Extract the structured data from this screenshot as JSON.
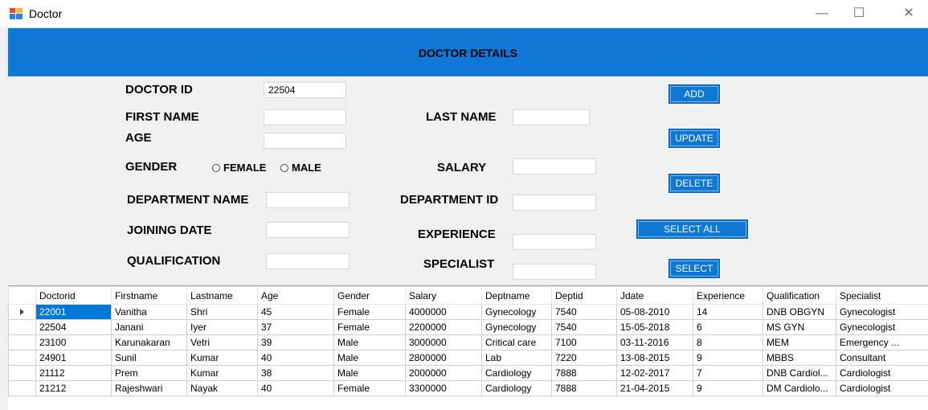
{
  "window": {
    "title": "Doctor",
    "minimize": "—",
    "maximize": "☐",
    "close": "✕"
  },
  "header": {
    "title": "DOCTOR DETAILS"
  },
  "form": {
    "doctor_id_label": "DOCTOR ID",
    "doctor_id_value": "22504",
    "first_name_label": "FIRST NAME",
    "last_name_label": "LAST NAME",
    "age_label": "AGE",
    "gender_label": "GENDER",
    "female_label": "FEMALE",
    "male_label": "MALE",
    "salary_label": "SALARY",
    "department_name_label": "DEPARTMENT NAME",
    "department_id_label": "DEPARTMENT ID",
    "joining_date_label": "JOINING DATE",
    "experience_label": "EXPERIENCE",
    "qualification_label": "QUALIFICATION",
    "specialist_label": "SPECIALIST"
  },
  "buttons": {
    "add": "ADD",
    "update": "UPDATE",
    "delete": "DELETE",
    "select_all": "SELECT ALL",
    "select": "SELECT"
  },
  "table": {
    "columns": [
      "Doctorid",
      "Firstname",
      "Lastname",
      "Age",
      "Gender",
      "Salary",
      "Deptname",
      "Deptid",
      "Jdate",
      "Experience",
      "Qualification",
      "Specialist"
    ],
    "rows": [
      [
        "22001",
        "Vanitha",
        "Shri",
        "45",
        "Female",
        "4000000",
        "Gynecology",
        "7540",
        "05-08-2010",
        "14",
        "DNB OBGYN",
        "Gynecologist"
      ],
      [
        "22504",
        "Janani",
        "Iyer",
        "37",
        "Female",
        "2200000",
        "Gynecology",
        "7540",
        "15-05-2018",
        "6",
        "MS GYN",
        "Gynecologist"
      ],
      [
        "23100",
        "Karunakaran",
        "Vetri",
        "39",
        "Male",
        "3000000",
        "Critical care",
        "7100",
        "03-11-2016",
        "8",
        "MEM",
        "Emergency ..."
      ],
      [
        "24901",
        "Sunil",
        "Kumar",
        "40",
        "Male",
        "2800000",
        "Lab",
        "7220",
        "13-08-2015",
        "9",
        "MBBS",
        "Consultant"
      ],
      [
        "21112",
        "Prem",
        "Kumar",
        "38",
        "Male",
        "2000000",
        "Cardiology",
        "7888",
        "12-02-2017",
        "7",
        "DNB Cardiol...",
        "Cardiologist"
      ],
      [
        "21212",
        "Rajeshwari",
        "Nayak",
        "40",
        "Female",
        "3300000",
        "Cardiology",
        "7888",
        "21-04-2015",
        "9",
        "DM Cardiolo...",
        "Cardiologist"
      ]
    ]
  }
}
